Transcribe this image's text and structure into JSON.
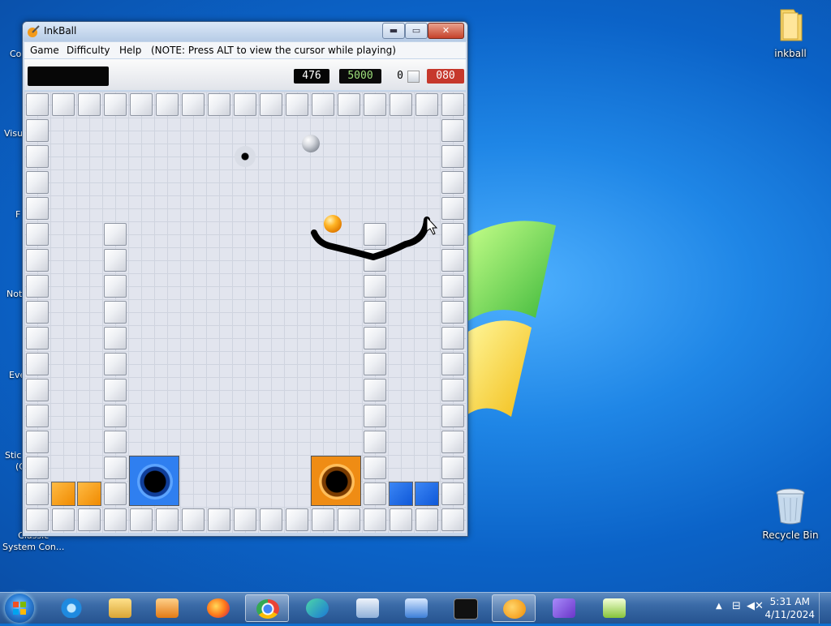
{
  "desktop": {
    "icons": [
      {
        "name": "inkball",
        "label": "inkball"
      },
      {
        "name": "recycle-bin",
        "label": "Recycle Bin"
      }
    ],
    "left_clipped_labels": [
      "Co",
      "Visu",
      "F",
      "Not",
      "Eve",
      "Stic",
      "(C",
      "Classic\nSystem Con..."
    ]
  },
  "window": {
    "title": "InkBall",
    "buttons": {
      "minimize": "▬",
      "maximize": "▭",
      "close": "✕"
    },
    "menu": [
      "Game",
      "Difficulty",
      "Help",
      "(NOTE: Press ALT to view the cursor while playing)"
    ],
    "scores": {
      "score": "476",
      "target": "5000",
      "count": "0",
      "timer": "080"
    }
  },
  "game": {
    "colors": {
      "orange": "#f08a00",
      "blue": "#1f6ae6",
      "board": "#e2e5ee"
    }
  },
  "taskbar": {
    "items": [
      "start",
      "internet-explorer",
      "file-explorer",
      "media-player",
      "firefox",
      "chrome",
      "edge",
      "remote-desktop",
      "network-tool",
      "command-prompt",
      "inkball",
      "visual-studio",
      "notepad-plus"
    ],
    "clock": {
      "time": "5:31 AM",
      "date": "4/11/2024"
    }
  }
}
